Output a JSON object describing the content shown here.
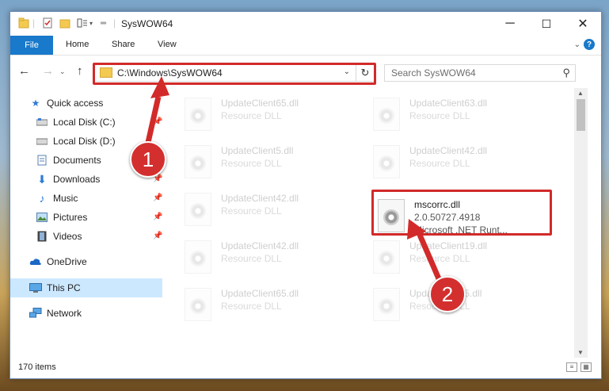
{
  "window": {
    "title": "SysWOW64"
  },
  "ribbon": {
    "file": "File",
    "tabs": [
      "Home",
      "Share",
      "View"
    ]
  },
  "nav": {
    "address": "C:\\Windows\\SysWOW64",
    "search_placeholder": "Search SysWOW64"
  },
  "sidebar": {
    "items": [
      {
        "label": "Quick access",
        "icon": "star-icon"
      },
      {
        "label": "Local Disk (C:)",
        "icon": "disk-icon"
      },
      {
        "label": "Local Disk (D:)",
        "icon": "disk-icon"
      },
      {
        "label": "Documents",
        "icon": "documents-icon"
      },
      {
        "label": "Downloads",
        "icon": "downloads-icon"
      },
      {
        "label": "Music",
        "icon": "music-icon"
      },
      {
        "label": "Pictures",
        "icon": "pictures-icon"
      },
      {
        "label": "Videos",
        "icon": "videos-icon"
      },
      {
        "label": "OneDrive",
        "icon": "cloud-icon"
      },
      {
        "label": "This PC",
        "icon": "computer-icon"
      },
      {
        "label": "Network",
        "icon": "network-icon"
      }
    ]
  },
  "files": [
    {
      "name": "UpdateClient65.dll",
      "desc": "Resource DLL"
    },
    {
      "name": "UpdateClient63.dll",
      "desc": "Resource DLL"
    },
    {
      "name": "UpdateClient5.dll",
      "desc": "Resource DLL"
    },
    {
      "name": "UpdateClient42.dll",
      "desc": "Resource DLL"
    },
    {
      "name": "UpdateClient42.dll",
      "desc": "Resource DLL"
    },
    {
      "name": "mscorrc.dll",
      "version": "2.0.50727.4918",
      "desc": "Microsoft .NET Runt..."
    },
    {
      "name": "UpdateClient42.dll",
      "desc": "Resource DLL"
    },
    {
      "name": "UpdateClient19.dll",
      "desc": "Resource DLL"
    },
    {
      "name": "UpdateClient65.dll",
      "desc": "Resource DLL"
    },
    {
      "name": "UpdateClient5.dll",
      "desc": "Resource DLL"
    }
  ],
  "status": {
    "count": "170 items"
  },
  "annotations": {
    "step1": "1",
    "step2": "2",
    "color": "#d22a2a"
  }
}
